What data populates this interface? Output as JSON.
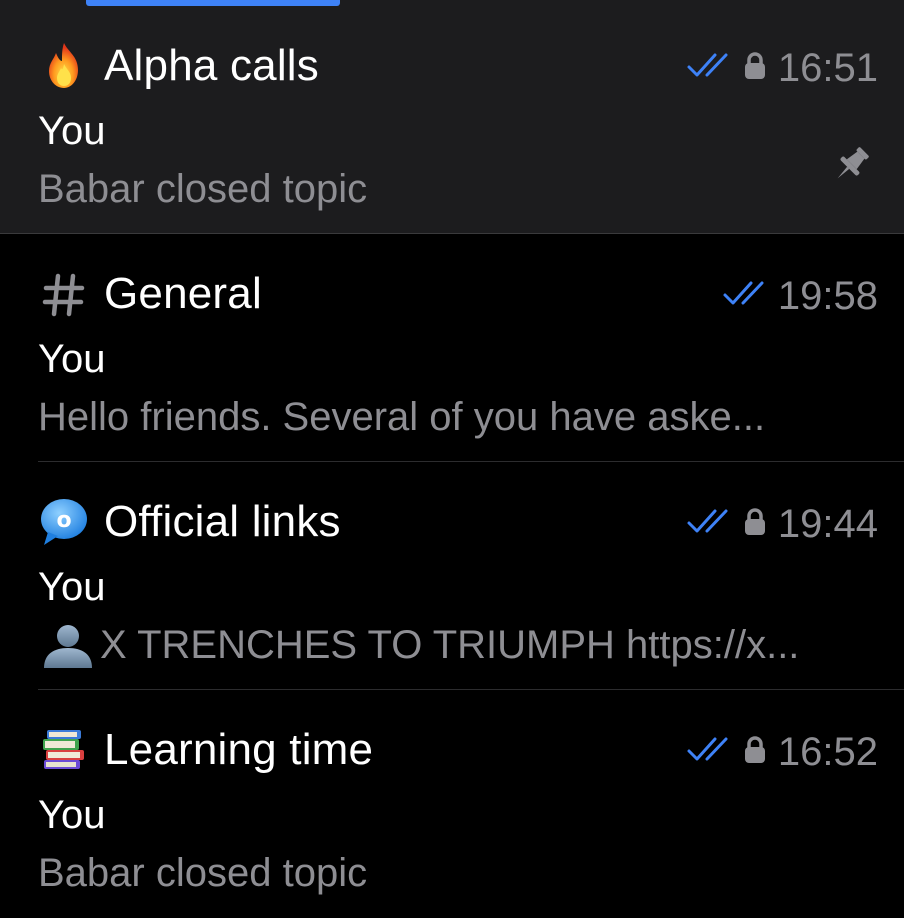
{
  "colors": {
    "background": "#000000",
    "pinned_row_background": "#1c1c1e",
    "tab_indicator": "#3e82f7",
    "read_checks": "#3e82f7",
    "secondary_text": "#8e8e93"
  },
  "topics": [
    {
      "icon": "fire-emoji-icon",
      "title": "Alpha calls",
      "read": true,
      "locked": true,
      "time": "16:51",
      "sender": "You",
      "preview": "Babar closed topic",
      "pinned": true
    },
    {
      "icon": "hash-icon",
      "title": "General",
      "read": true,
      "locked": false,
      "time": "19:58",
      "sender": "You",
      "preview": "Hello friends. Several of you have aske...",
      "pinned": false
    },
    {
      "icon": "speech-bubble-o-icon",
      "title": "Official links",
      "read": true,
      "locked": true,
      "time": "19:44",
      "sender": "You",
      "preview_icon": "bust-silhouette-icon",
      "preview": "X TRENCHES TO TRIUMPH https://x...",
      "pinned": false
    },
    {
      "icon": "books-emoji-icon",
      "title": "Learning time",
      "read": true,
      "locked": true,
      "time": "16:52",
      "sender": "You",
      "preview": "Babar closed topic",
      "pinned": false
    }
  ],
  "icon_glyphs": {
    "bubble_letter": "o"
  }
}
